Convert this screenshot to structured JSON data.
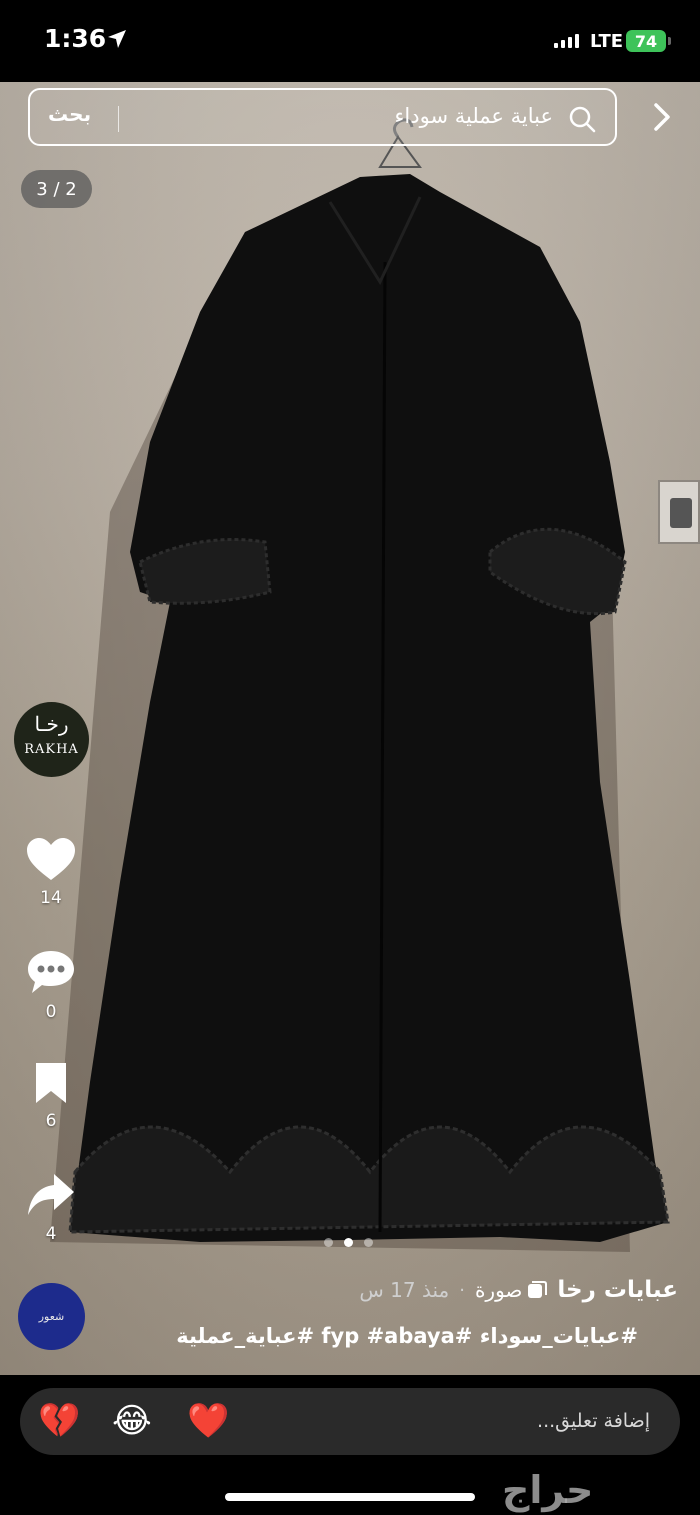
{
  "status_bar": {
    "time": "1:36",
    "network": "LTE",
    "battery": "74"
  },
  "search": {
    "button_label": "بحث",
    "query": "عباية عملية سوداء"
  },
  "gallery": {
    "counter": "3 / 2",
    "active_dot": 2,
    "dot_count": 3
  },
  "shop": {
    "avatar_arabic": "رخـا",
    "avatar_latin": "RAKHA"
  },
  "actions": {
    "likes": "14",
    "comments": "0",
    "saves": "6",
    "shares": "4"
  },
  "post": {
    "author": "عبايات رخا",
    "type": "صورة",
    "time": "منذ 17 س",
    "separator": "·",
    "hashtags": "#عبايات_سوداء #fyp #abaya #عباية_عملية",
    "user_avatar_text": "شعور"
  },
  "comment_bar": {
    "placeholder": "إضافة تعليق...",
    "emojis": [
      "💔",
      "😂",
      "❤️"
    ]
  },
  "watermark": "حراج",
  "colors": {
    "battery": "#3ec35a",
    "like_heart": "#e0141e",
    "user_avatar": "#1d2b8c"
  }
}
